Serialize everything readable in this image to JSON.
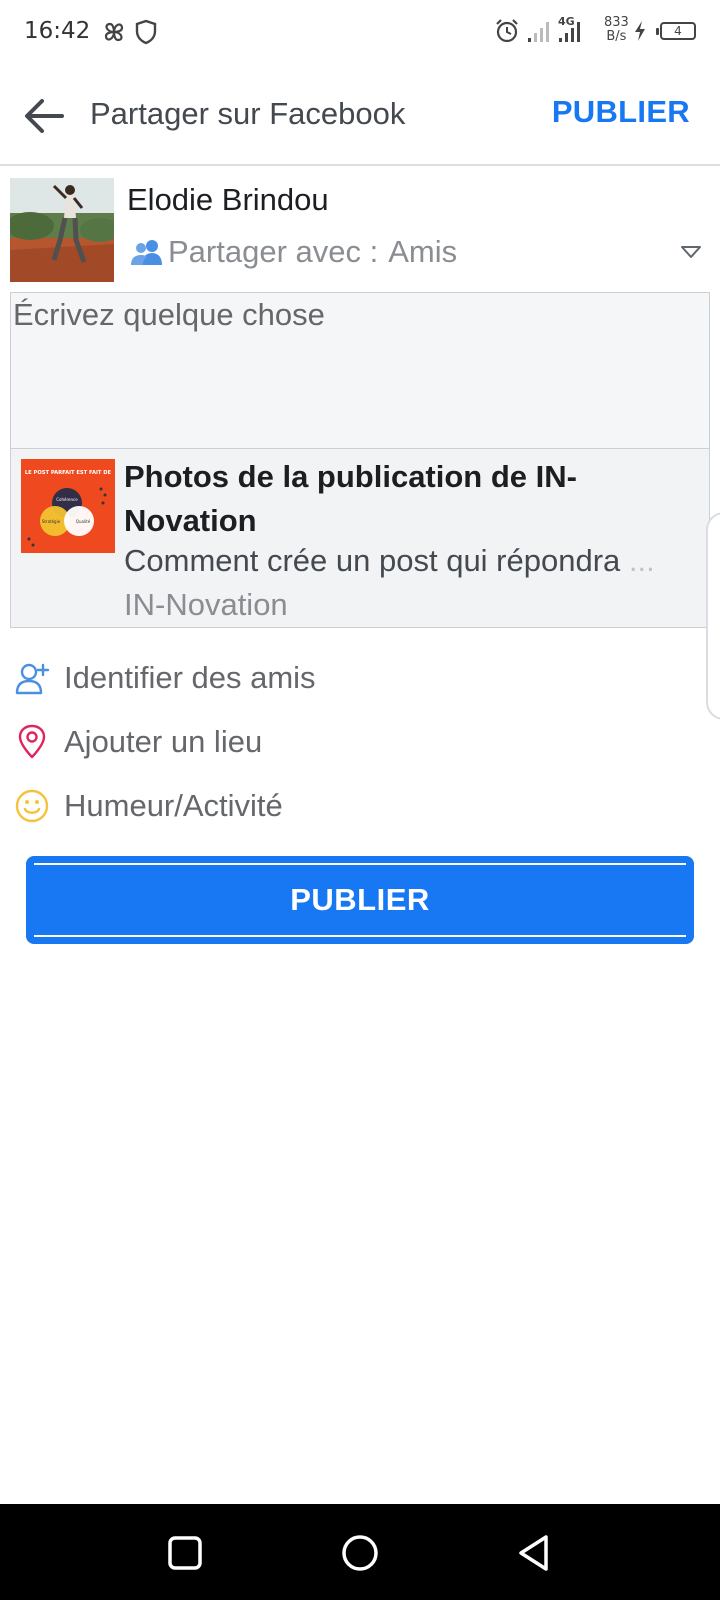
{
  "status_bar": {
    "time": "16:42",
    "network": "4G",
    "speed_value": "833",
    "speed_unit": "B/s",
    "battery": "4",
    "icons": [
      "pinwheel-icon",
      "shield-icon",
      "alarm-icon",
      "signal-icon",
      "signal-4g-icon",
      "charging-icon",
      "battery-icon"
    ]
  },
  "app_bar": {
    "title": "Partager sur Facebook",
    "publish_label": "PUBLIER",
    "back_icon": "back-arrow-icon"
  },
  "composer": {
    "user_name": "Elodie Brindou",
    "audience_label": "Partager avec :",
    "audience_value": "Amis",
    "placeholder": "Écrivez quelque chose"
  },
  "link_preview": {
    "thumbnail_text": "LE POST PARFAIT EST FAIT DE",
    "thumbnail_labels": [
      "Cohérence",
      "Stratégie",
      "Qualité"
    ],
    "title": "Photos de la publication de IN-Novation",
    "description": "Comment crée un post qui répondra ",
    "ellipsis": "...",
    "source": "IN-Novation"
  },
  "options": [
    {
      "label": "Identifier des amis",
      "icon": "add-friend-icon",
      "color": "#4a90e2"
    },
    {
      "label": "Ajouter un lieu",
      "icon": "location-pin-icon",
      "color": "#e0245e"
    },
    {
      "label": "Humeur/Activité",
      "icon": "smiley-icon",
      "color": "#f5c33b"
    }
  ],
  "publish_button": {
    "label": "PUBLIER"
  },
  "colors": {
    "accent": "#1877f2",
    "text_secondary": "#65676b",
    "field_bg": "#f5f6f7"
  },
  "nav_bar": {
    "icons": [
      "recents-square-icon",
      "home-circle-icon",
      "back-triangle-icon"
    ]
  }
}
